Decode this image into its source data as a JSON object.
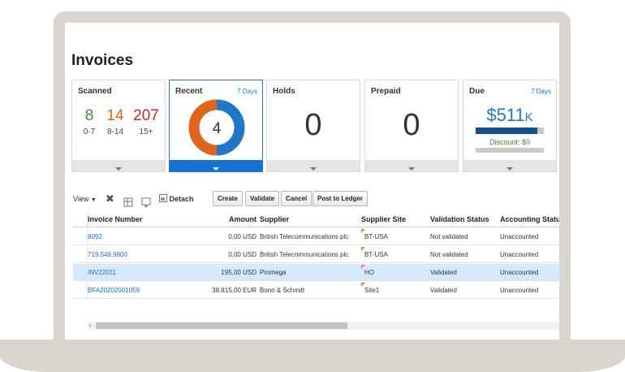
{
  "page": {
    "title": "Invoices"
  },
  "tiles": {
    "scanned": {
      "title": "Scanned",
      "buckets": [
        {
          "value": "8",
          "label": "0-7",
          "color": "#3f8d2c"
        },
        {
          "value": "14",
          "label": "8-14",
          "color": "#e0651c"
        },
        {
          "value": "207",
          "label": "15+",
          "color": "#c42a1f"
        }
      ]
    },
    "recent": {
      "title": "Recent",
      "range": "7 Days",
      "count": "4",
      "donut": {
        "orange_fraction": 0.5,
        "blue_fraction": 0.5,
        "colors": [
          "#1f78c8",
          "#e0651c"
        ]
      }
    },
    "holds": {
      "title": "Holds",
      "count": "0"
    },
    "prepaid": {
      "title": "Prepaid",
      "count": "0"
    },
    "due": {
      "title": "Due",
      "range": "7 Days",
      "amount": "$511",
      "unit": "K",
      "discount": "Discount: $0",
      "bar_fraction": 0.9
    }
  },
  "toolbar": {
    "view_label": "View",
    "detach_label": "Detach",
    "buttons": [
      "Create",
      "Validate",
      "Cancel",
      "Post to Ledger"
    ]
  },
  "table": {
    "columns": [
      "Invoice Number",
      "Amount",
      "Supplier",
      "Supplier Site",
      "Validation Status",
      "Accounting Status"
    ],
    "rows": [
      [
        "8092",
        "0,00 USD",
        "British Telecommunications plc",
        "BT-USA",
        "Not validated",
        "Unaccounted"
      ],
      [
        "719.548,9800",
        "0,00 USD",
        "British Telecommunications plc",
        "BT-USA",
        "Not validated",
        "Unaccounted"
      ],
      [
        "INV22011",
        "195,00 USD",
        "Promega",
        "HO",
        "Validated",
        "Unaccounted"
      ],
      [
        "BFA20202001059",
        "38.815,00 EUR",
        "Bonn & Schmitt",
        "Site1",
        "Validated",
        "Unaccounted"
      ]
    ],
    "selected_row": 2
  }
}
